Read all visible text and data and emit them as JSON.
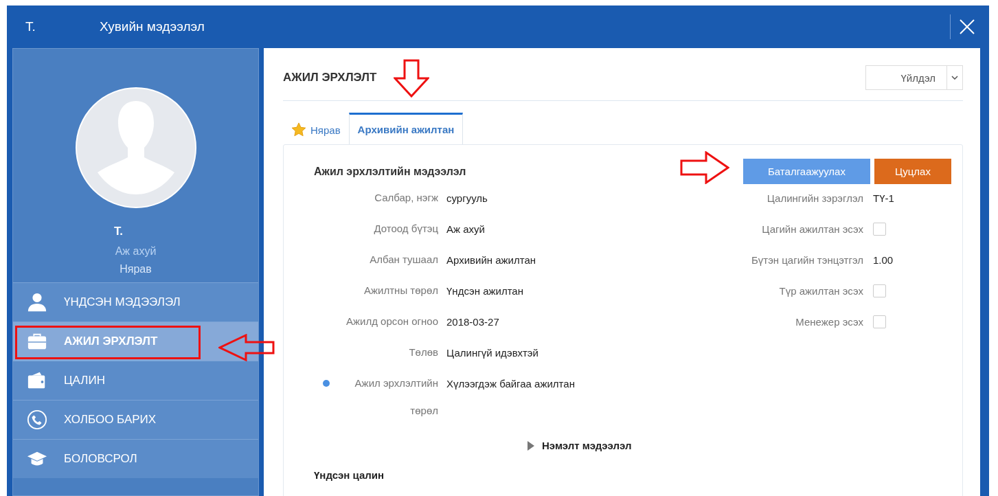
{
  "window": {
    "badge": "Т.",
    "title": "Хувийн мэдээлэл"
  },
  "profile": {
    "name": "Т.",
    "department": "Аж ахуй",
    "position": "Нярав"
  },
  "sidebar": {
    "items": [
      {
        "label": "ҮНДСЭН МЭДЭЭЛЭЛ",
        "selected": false
      },
      {
        "label": "АЖИЛ ЭРХЛЭЛТ",
        "selected": true
      },
      {
        "label": "ЦАЛИН",
        "selected": false
      },
      {
        "label": "ХОЛБОО БАРИХ",
        "selected": false
      },
      {
        "label": "БОЛОВСРОЛ",
        "selected": false
      }
    ]
  },
  "section": {
    "title": "АЖИЛ ЭРХЛЭЛТ",
    "action_select": "Үйлдэл"
  },
  "tabs": [
    {
      "label": "Нярав",
      "selected": false
    },
    {
      "label": "Архивийн ажилтан",
      "selected": true
    }
  ],
  "form": {
    "heading": "Ажил эрхлэлтийн мэдээлэл",
    "buttons": [
      {
        "label": "Баталгаажуулах",
        "kind": "primary"
      },
      {
        "label": "Цуцлах",
        "kind": "danger"
      }
    ],
    "left_fields": [
      {
        "label": "Салбар, нэгж",
        "value": "сургууль",
        "required": false
      },
      {
        "label": "Дотоод бүтэц",
        "value": "Аж ахуй",
        "required": false
      },
      {
        "label": "Албан тушаал",
        "value": "Архивийн ажилтан",
        "required": false
      },
      {
        "label": "Ажилтны төрөл",
        "value": "Үндсэн ажилтан",
        "required": false
      },
      {
        "label": "Ажилд орсон огноо",
        "value": "2018-03-27",
        "required": false
      },
      {
        "label": "Төлөв",
        "value": "Цалингүй идэвхтэй",
        "required": false
      },
      {
        "label": "Ажил эрхлэлтийн төрөл",
        "value": "Хүлээгдэж байгаа ажилтан",
        "required": true
      }
    ],
    "right_fields": [
      {
        "label": "Цалингийн зэрэглэл",
        "kind": "text",
        "value": "ТҮ-1"
      },
      {
        "label": "Цагийн ажилтан эсэх",
        "kind": "checkbox",
        "checked": false
      },
      {
        "label": "Бүтэн цагийн тэнцэтгэл",
        "kind": "text",
        "value": "1.00"
      },
      {
        "label": "Түр ажилтан эсэх",
        "kind": "checkbox",
        "checked": false
      },
      {
        "label": "Менежер эсэх",
        "kind": "checkbox",
        "checked": false
      }
    ],
    "more_toggle": {
      "label": "Нэмэлт мэдээлэл",
      "expanded": false
    },
    "subheading": "Үндсэн цалин"
  }
}
